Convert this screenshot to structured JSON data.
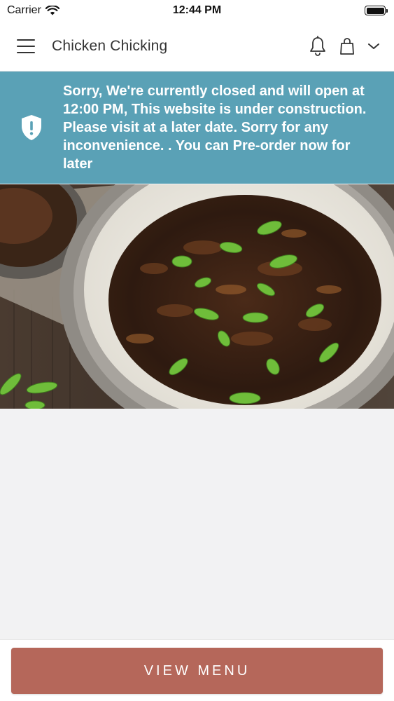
{
  "status_bar": {
    "carrier": "Carrier",
    "time": "12:44 PM"
  },
  "header": {
    "title": "Chicken Chicking",
    "icons": [
      "menu-icon",
      "bell-icon",
      "shopping-bag-icon",
      "chevron-down-icon"
    ]
  },
  "banner": {
    "message": "Sorry, We're currently closed and will open at 12:00 PM, This website is under construction. Please visit at a later date. Sorry for any inconvenience. . You can Pre-order now for later",
    "background_color": "#5aa1b6",
    "icon": "shield-alert-icon"
  },
  "footer": {
    "view_menu_label": "VIEW MENU",
    "button_color": "#b5675a"
  }
}
